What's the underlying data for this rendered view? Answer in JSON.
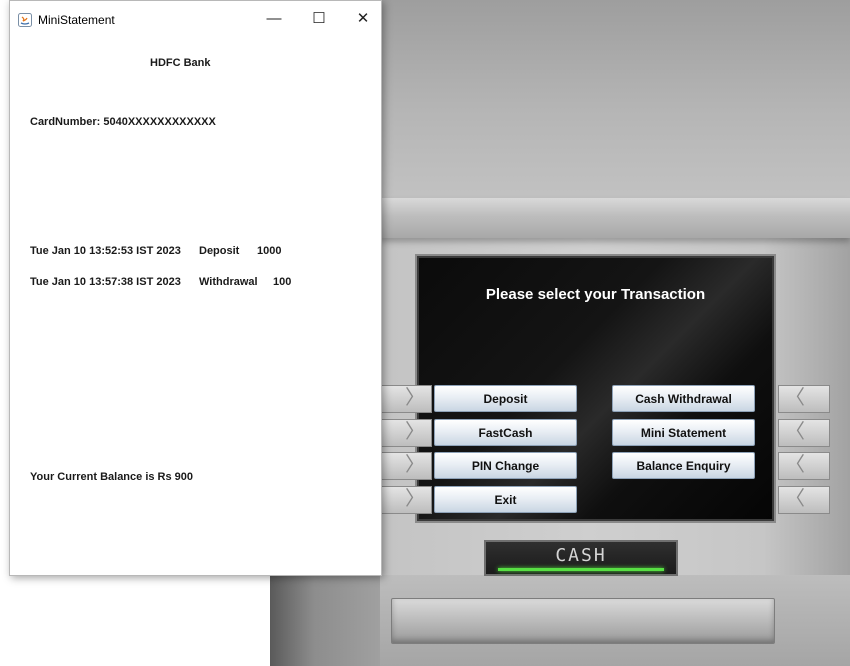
{
  "window": {
    "title": "MiniStatement",
    "controls": {
      "minimize": "—",
      "maximize": "☐",
      "close": "✕"
    }
  },
  "statement": {
    "bank_name": "HDFC Bank",
    "card_number": "CardNumber: 5040XXXXXXXXXXXX",
    "transactions": [
      {
        "date": "Tue Jan 10 13:52:53 IST 2023",
        "type": "Deposit",
        "amount": "1000"
      },
      {
        "date": "Tue Jan 10 13:57:38 IST 2023",
        "type": "Withdrawal",
        "amount": "100"
      }
    ],
    "balance": "Your Current Balance is Rs 900"
  },
  "atm": {
    "screen_title": "Please select your Transaction",
    "buttons": {
      "deposit": "Deposit",
      "cash_withdrawal": "Cash Withdrawal",
      "fastcash": "FastCash",
      "mini_statement": "Mini Statement",
      "pin_change": "PIN Change",
      "balance_enquiry": "Balance Enquiry",
      "exit": "Exit"
    },
    "cash_label": "CASH",
    "side_key_left": "〉",
    "side_key_right": "〈"
  }
}
